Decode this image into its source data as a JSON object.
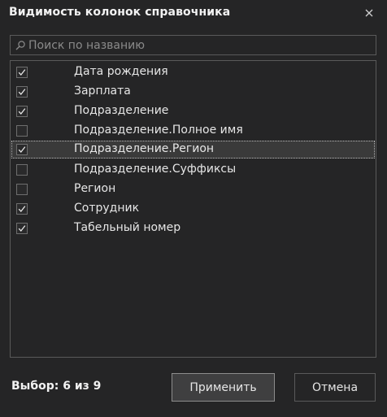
{
  "dialog": {
    "title": "Видимость колонок справочника"
  },
  "search": {
    "placeholder": "Поиск по названию",
    "value": ""
  },
  "columns": [
    {
      "label": "Дата рождения",
      "checked": true,
      "selected": false
    },
    {
      "label": "Зарплата",
      "checked": true,
      "selected": false
    },
    {
      "label": "Подразделение",
      "checked": true,
      "selected": false
    },
    {
      "label": "Подразделение.Полное имя",
      "checked": false,
      "selected": false
    },
    {
      "label": "Подразделение.Регион",
      "checked": true,
      "selected": true
    },
    {
      "label": "Подразделение.Суффиксы",
      "checked": false,
      "selected": false
    },
    {
      "label": "Регион",
      "checked": false,
      "selected": false
    },
    {
      "label": "Сотрудник",
      "checked": true,
      "selected": false
    },
    {
      "label": "Табельный номер",
      "checked": true,
      "selected": false
    }
  ],
  "footer": {
    "selection_text": "Выбор: 6 из 9",
    "apply_label": "Применить",
    "cancel_label": "Отмена"
  },
  "icons": {
    "close": "close-icon",
    "search": "search-icon",
    "check": "check-icon"
  },
  "colors": {
    "background": "#252526",
    "border": "#5a5a5a",
    "text": "#e6e6e6",
    "selected_row": "#3a3a3a"
  }
}
